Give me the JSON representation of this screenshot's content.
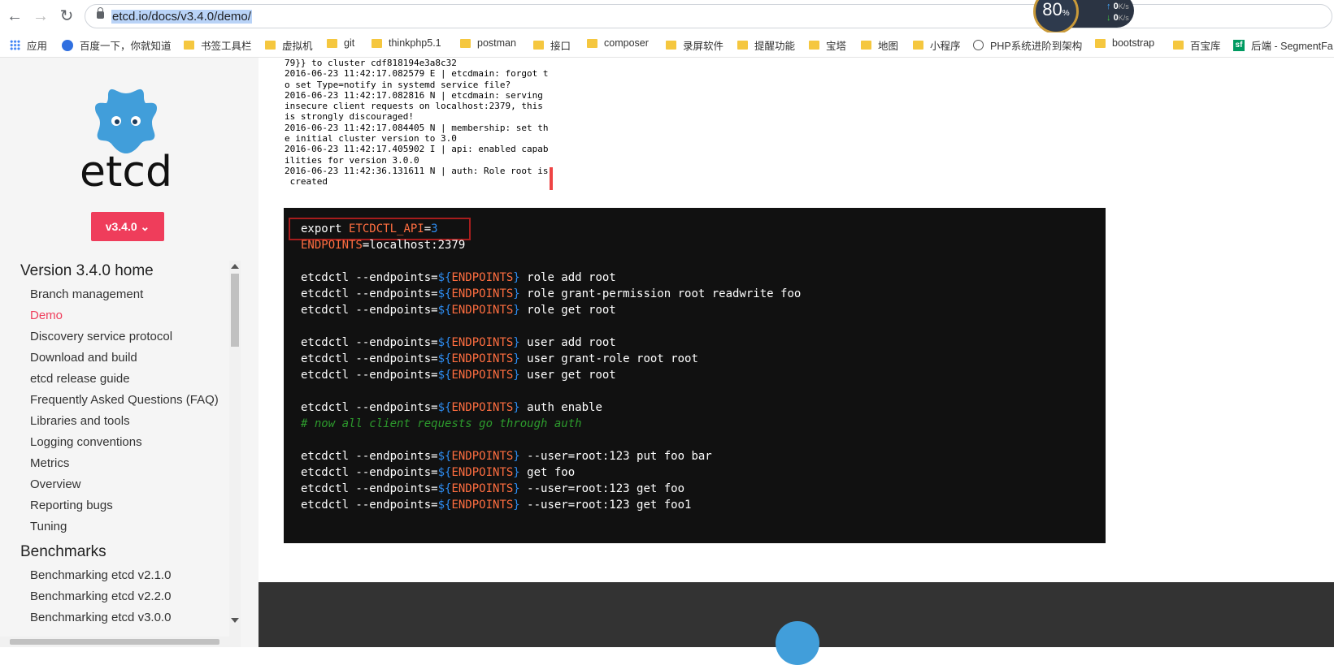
{
  "browser": {
    "url": "etcd.io/docs/v3.4.0/demo/",
    "perf_percent": "80",
    "perf_unit": "%",
    "perf_up": "0",
    "perf_down": "0",
    "perf_rate_unit": "K/s"
  },
  "bookmarks": [
    {
      "label": "应用",
      "icon": "apps-icon"
    },
    {
      "label": "百度一下，你就知道",
      "icon": "baidu-paw-icon"
    },
    {
      "label": "书签工具栏",
      "icon": "folder-icon"
    },
    {
      "label": "虚拟机",
      "icon": "folder-icon"
    },
    {
      "label": "git",
      "icon": "folder-icon"
    },
    {
      "label": "thinkphp5.1",
      "icon": "folder-icon"
    },
    {
      "label": "postman",
      "icon": "folder-icon"
    },
    {
      "label": "接口",
      "icon": "folder-icon"
    },
    {
      "label": "composer",
      "icon": "folder-icon"
    },
    {
      "label": "录屏软件",
      "icon": "folder-icon"
    },
    {
      "label": "提醒功能",
      "icon": "folder-icon"
    },
    {
      "label": "宝塔",
      "icon": "folder-icon"
    },
    {
      "label": "地图",
      "icon": "folder-icon"
    },
    {
      "label": "小程序",
      "icon": "folder-icon"
    },
    {
      "label": "PHP系统进阶到架构",
      "icon": "globe-icon"
    },
    {
      "label": "bootstrap",
      "icon": "folder-icon"
    },
    {
      "label": "百宝库",
      "icon": "folder-icon"
    },
    {
      "label": "后端 - SegmentFa",
      "icon": "segmentfault-icon"
    }
  ],
  "sidebar": {
    "logo_text": "etcd",
    "version_label": "v3.4.0",
    "sections": [
      {
        "title": "Version 3.4.0 home",
        "items": [
          "Branch management",
          "Demo",
          "Discovery service protocol",
          "Download and build",
          "etcd release guide",
          "Frequently Asked Questions (FAQ)",
          "Libraries and tools",
          "Logging conventions",
          "Metrics",
          "Overview",
          "Reporting bugs",
          "Tuning"
        ]
      },
      {
        "title": "Benchmarks",
        "items": [
          "Benchmarking etcd v2.1.0",
          "Benchmarking etcd v2.2.0",
          "Benchmarking etcd v3.0.0"
        ]
      }
    ],
    "active_item": "Demo"
  },
  "terminal_image_lines": [
    "79}} to cluster cdf818194e3a8c32",
    "2016-06-23 11:42:17.082579 E | etcdmain: forgot t",
    "o set Type=notify in systemd service file?",
    "2016-06-23 11:42:17.082816 N | etcdmain: serving",
    "insecure client requests on localhost:2379, this",
    "is strongly discouraged!",
    "2016-06-23 11:42:17.084405 N | membership: set th",
    "e initial cluster version to 3.0",
    "2016-06-23 11:42:17.405902 I | api: enabled capab",
    "ilities for version 3.0.0",
    "2016-06-23 11:42:36.131611 N | auth: Role root is",
    " created"
  ],
  "code": {
    "l1_kw": "export ",
    "l1_var": "ETCDCTL_API",
    "l1_eq": "=",
    "l1_val": "3",
    "l2_var": "ENDPOINTS",
    "l2_rest": "=localhost:2379",
    "cmd_prefix": "etcdctl --endpoints=",
    "dollar_open": "${",
    "env_name": "ENDPOINTS",
    "close_brace": "}",
    "commands": [
      " role add root",
      " role grant-permission root readwrite foo",
      " role get root",
      " user add root",
      " user grant-role root root",
      " user get root",
      " auth enable",
      " --user=root:123 put foo bar",
      " get foo",
      " --user=root:123 get foo",
      " --user=root:123 get foo1"
    ],
    "comment": "# now all client requests go through auth"
  }
}
